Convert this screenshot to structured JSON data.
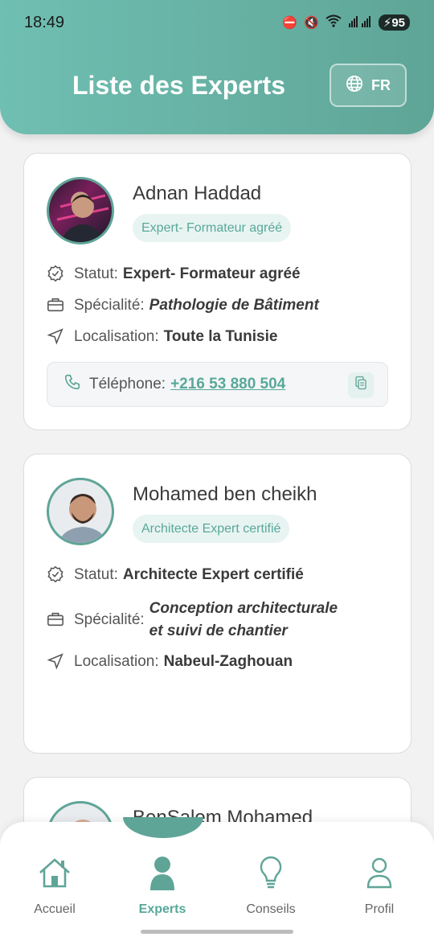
{
  "status_bar": {
    "time": "18:49",
    "battery": "95"
  },
  "header": {
    "title": "Liste des Experts",
    "lang": "FR"
  },
  "experts": [
    {
      "name": "Adnan Haddad",
      "badge": "Expert- Formateur agréé",
      "statut_label": "Statut:",
      "statut": "Expert- Formateur agréé",
      "specialite_label": "Spécialité:",
      "specialite": "Pathologie de Bâtiment",
      "localisation_label": "Localisation:",
      "localisation": "Toute la Tunisie",
      "telephone_label": "Téléphone:",
      "telephone": "+216 53 880 504"
    },
    {
      "name": "Mohamed ben cheikh",
      "badge": "Architecte Expert certifié",
      "statut_label": "Statut:",
      "statut": "Architecte Expert certifié",
      "specialite_label": "Spécialité:",
      "specialite_line1": "Conception architecturale",
      "specialite_line2": "et suivi de chantier",
      "localisation_label": "Localisation:",
      "localisation": "Nabeul-Zaghouan"
    },
    {
      "name": "BenSalem Mohamed"
    }
  ],
  "nav": {
    "items": [
      {
        "label": "Accueil",
        "icon": "home-icon"
      },
      {
        "label": "Experts",
        "icon": "person-icon"
      },
      {
        "label": "Conseils",
        "icon": "lightbulb-icon"
      },
      {
        "label": "Profil",
        "icon": "user-icon"
      }
    ],
    "active": "Experts"
  },
  "colors": {
    "accent": "#5fa597",
    "accent_light": "#e8f4f1",
    "background": "#f2f2f2"
  }
}
